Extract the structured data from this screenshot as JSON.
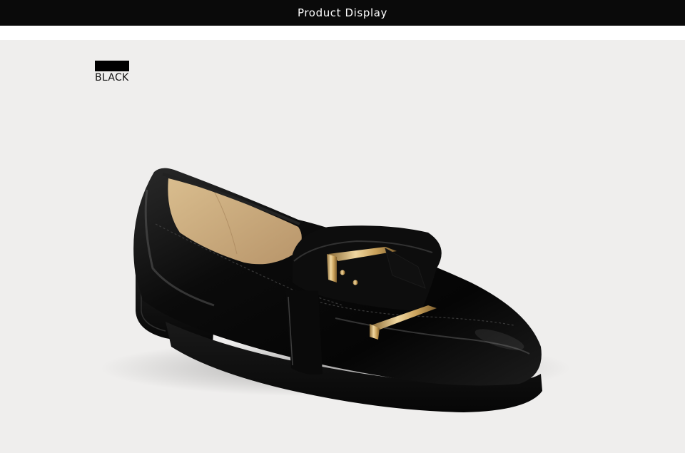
{
  "header": {
    "title": "Product Display"
  },
  "color_swatch": {
    "label": "BLACK",
    "color": "#000000"
  },
  "product_image": {
    "subject": "black patent leather loafer with gold buckle",
    "colors": {
      "background": "#efeeed",
      "leather": "#0b0b0b",
      "lining": "#c9a878",
      "hardware": "#c9a15a"
    }
  }
}
